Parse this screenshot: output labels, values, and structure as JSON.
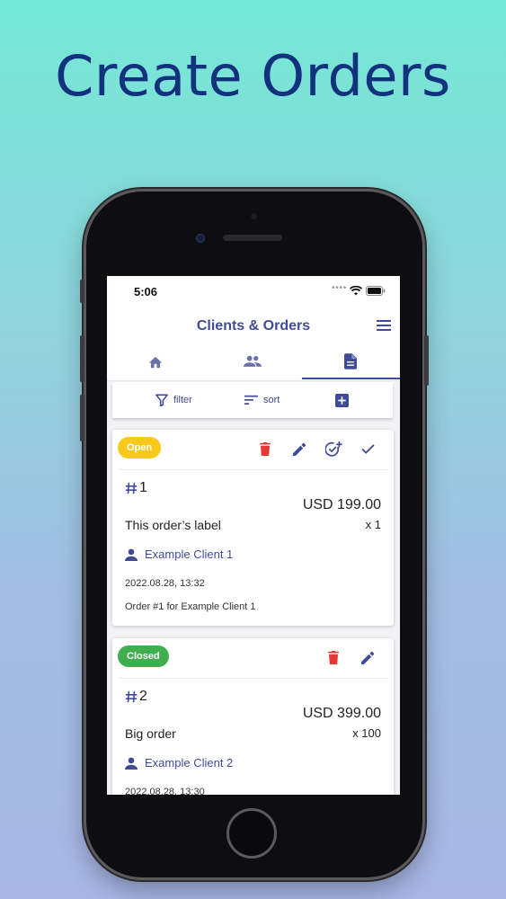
{
  "headline": "Create Orders",
  "status_bar": {
    "time": "5:06"
  },
  "app_bar": {
    "title": "Clients & Orders"
  },
  "tabs": [
    {
      "name": "home",
      "icon": "home-icon"
    },
    {
      "name": "clients",
      "icon": "people-icon"
    },
    {
      "name": "orders",
      "icon": "document-icon",
      "selected": true
    }
  ],
  "toolbar": {
    "filter_label": "filter",
    "sort_label": "sort"
  },
  "colors": {
    "accent": "#3f4b99",
    "open": "#f8c91a",
    "closed": "#3eae4e",
    "delete": "#e53935"
  },
  "orders": [
    {
      "status": "Open",
      "number": "1",
      "price": "USD 199.00",
      "label": "This order’s label",
      "quantity": "x 1",
      "client": "Example Client 1",
      "date": "2022.08.28, 13:32",
      "description": "Order #1 for Example Client 1"
    },
    {
      "status": "Closed",
      "number": "2",
      "price": "USD 399.00",
      "label": "Big order",
      "quantity": "x 100",
      "client": "Example Client 2",
      "date": "2022.08.28, 13:30"
    }
  ]
}
